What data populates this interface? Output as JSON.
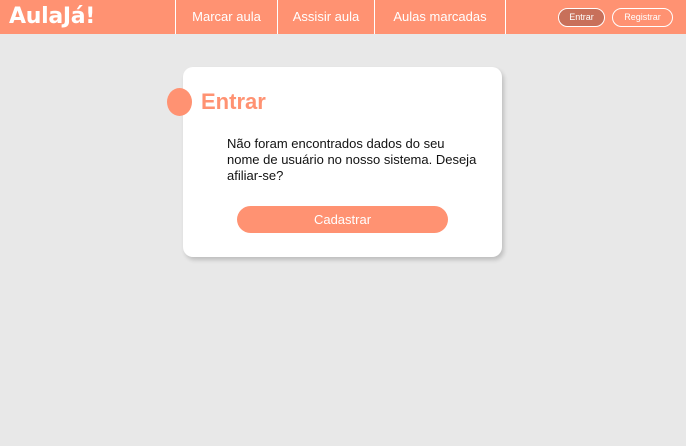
{
  "header": {
    "logo": "AulaJá!",
    "nav": [
      {
        "label": "Marcar aula"
      },
      {
        "label": "Assisir aula"
      },
      {
        "label": "Aulas marcadas"
      }
    ],
    "login_label": "Entrar",
    "register_label": "Registrar"
  },
  "dialog": {
    "title": "Entrar",
    "message": "Não foram encontrados dados do seu nome de usuário no nosso sistema. Deseja afiliar-se?",
    "button_label": "Cadastrar"
  },
  "colors": {
    "accent": "#ff9272",
    "background": "#e8e8e8",
    "card": "#ffffff",
    "login_pill": "#c8705a"
  }
}
